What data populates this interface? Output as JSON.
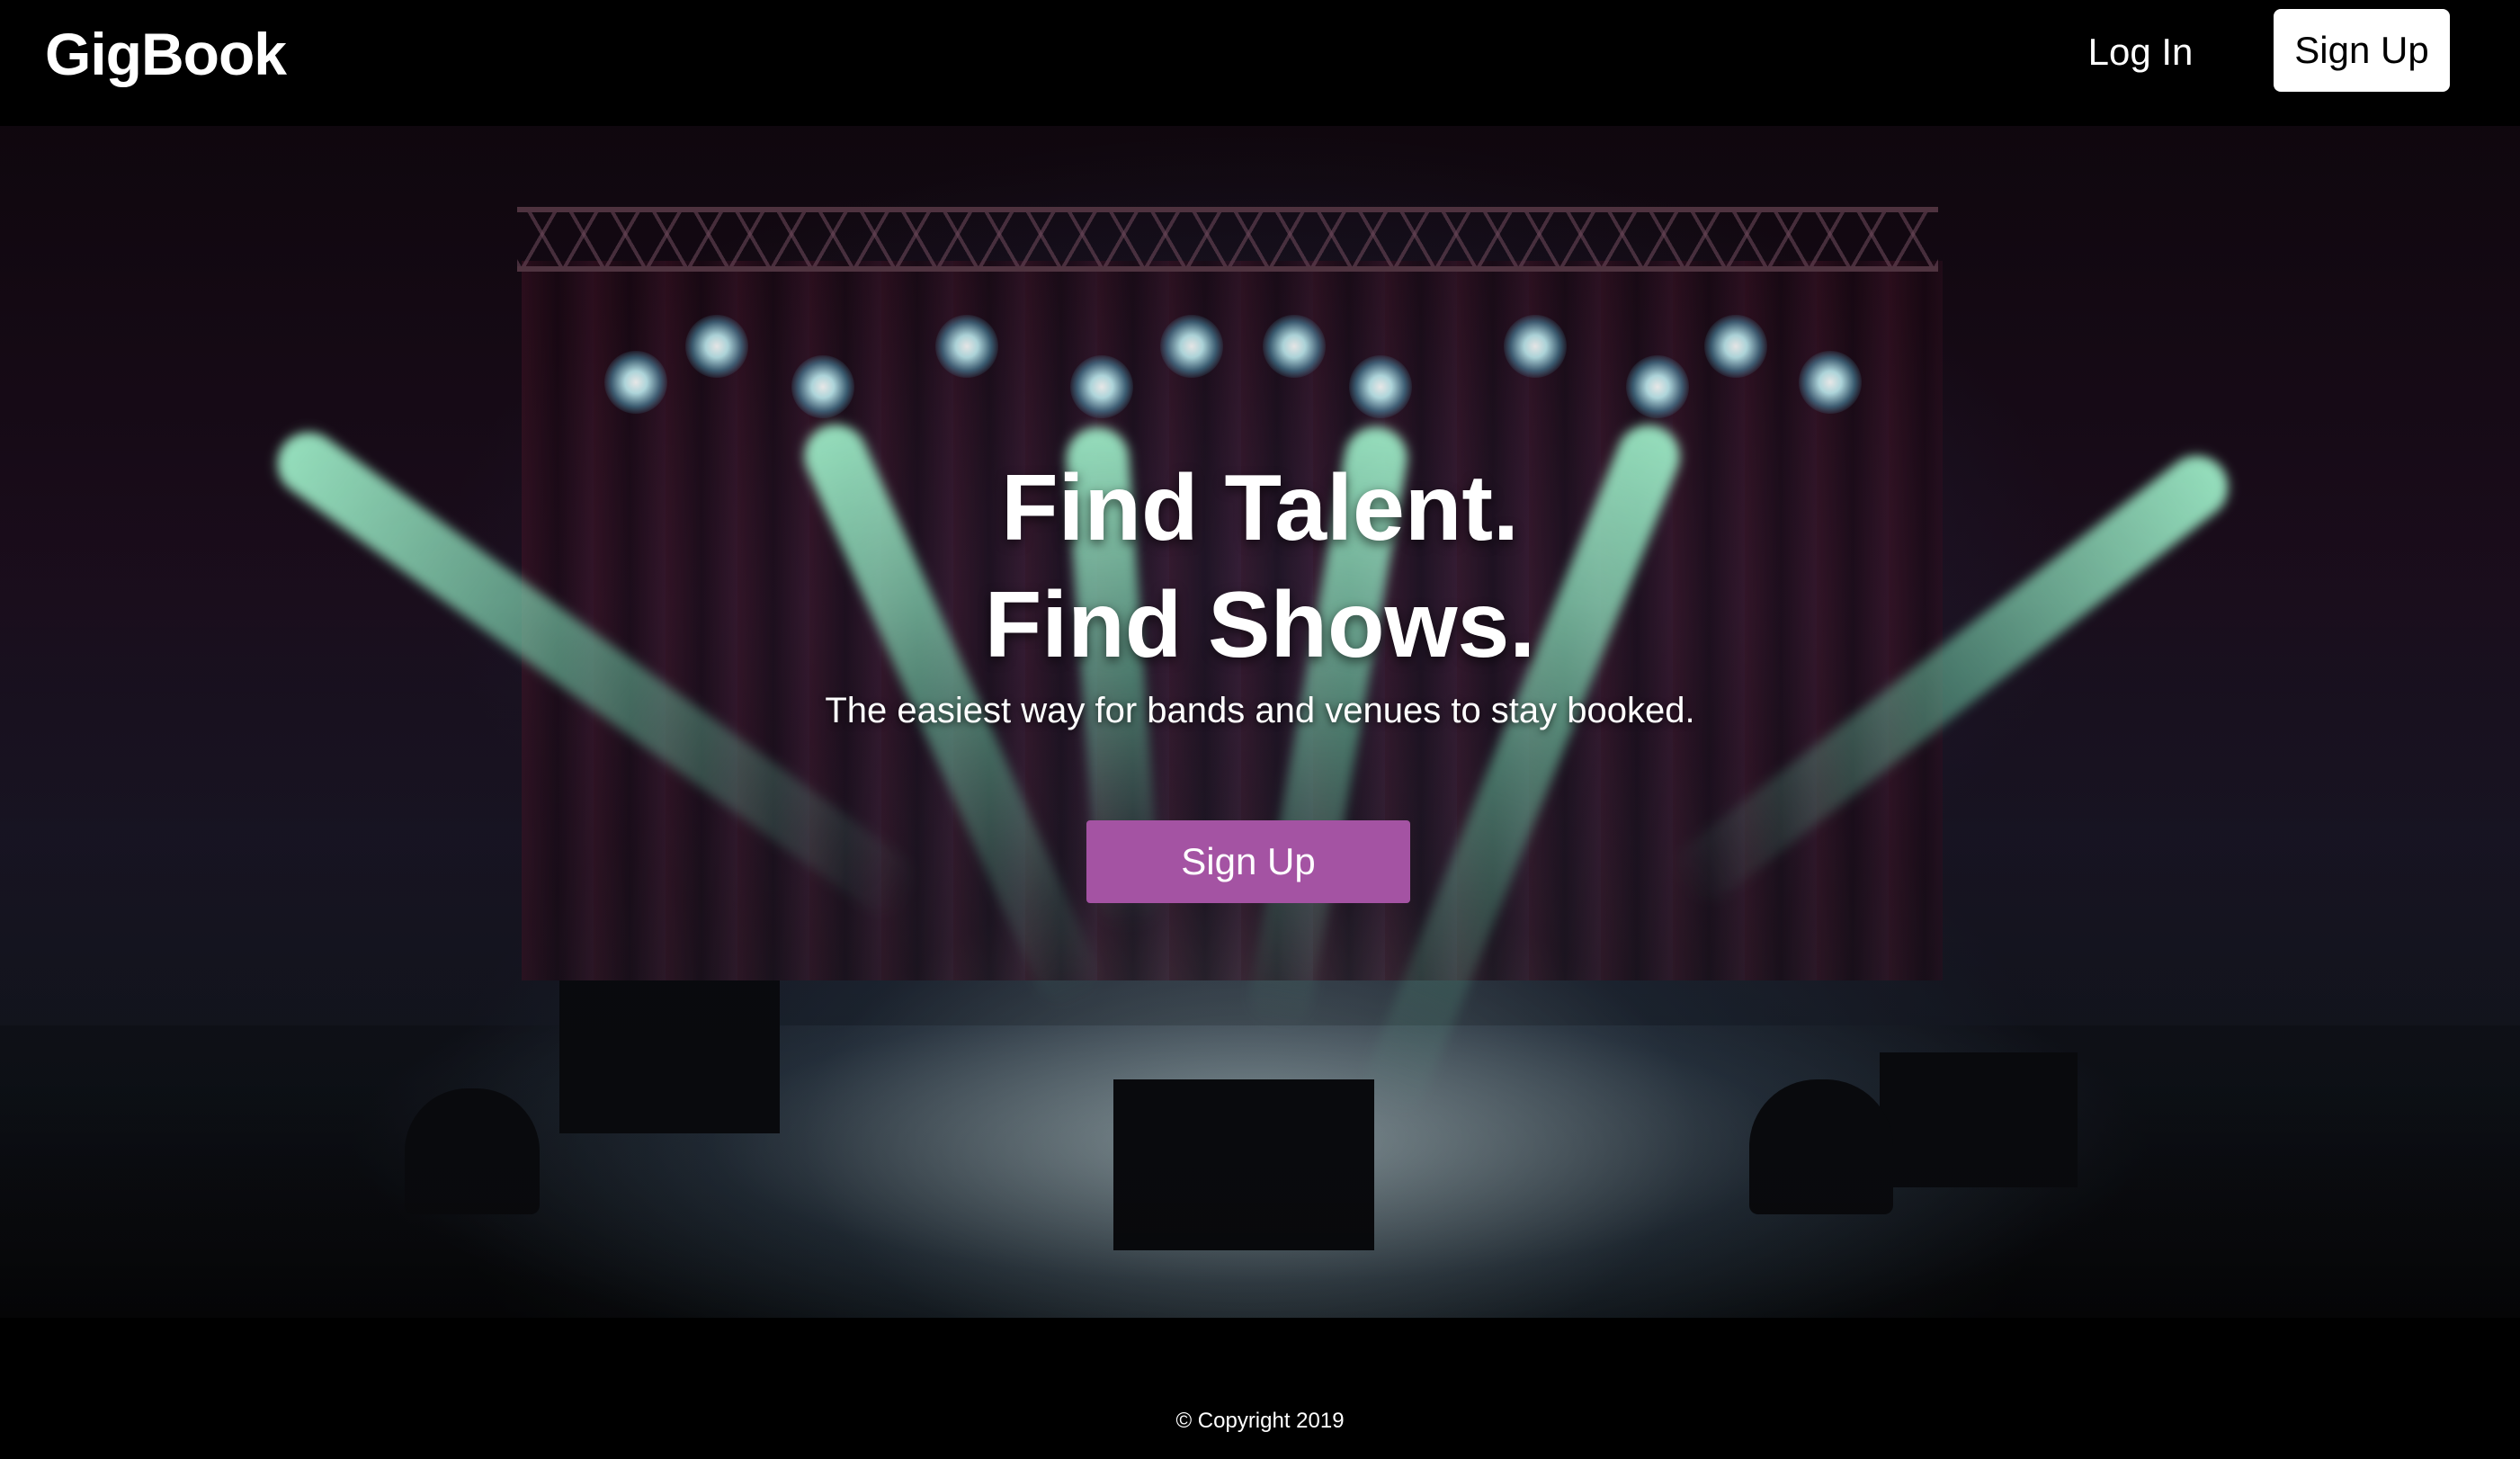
{
  "header": {
    "brand": "GigBook",
    "login_label": "Log In",
    "signup_label": "Sign Up"
  },
  "hero": {
    "headline_line1": "Find Talent.",
    "headline_line2": "Find Shows.",
    "subtitle": "The easiest way for bands and venues to stay booked.",
    "cta_label": "Sign Up",
    "cta_color": "#a453a3"
  },
  "footer": {
    "copyright": "© Copyright 2019"
  }
}
